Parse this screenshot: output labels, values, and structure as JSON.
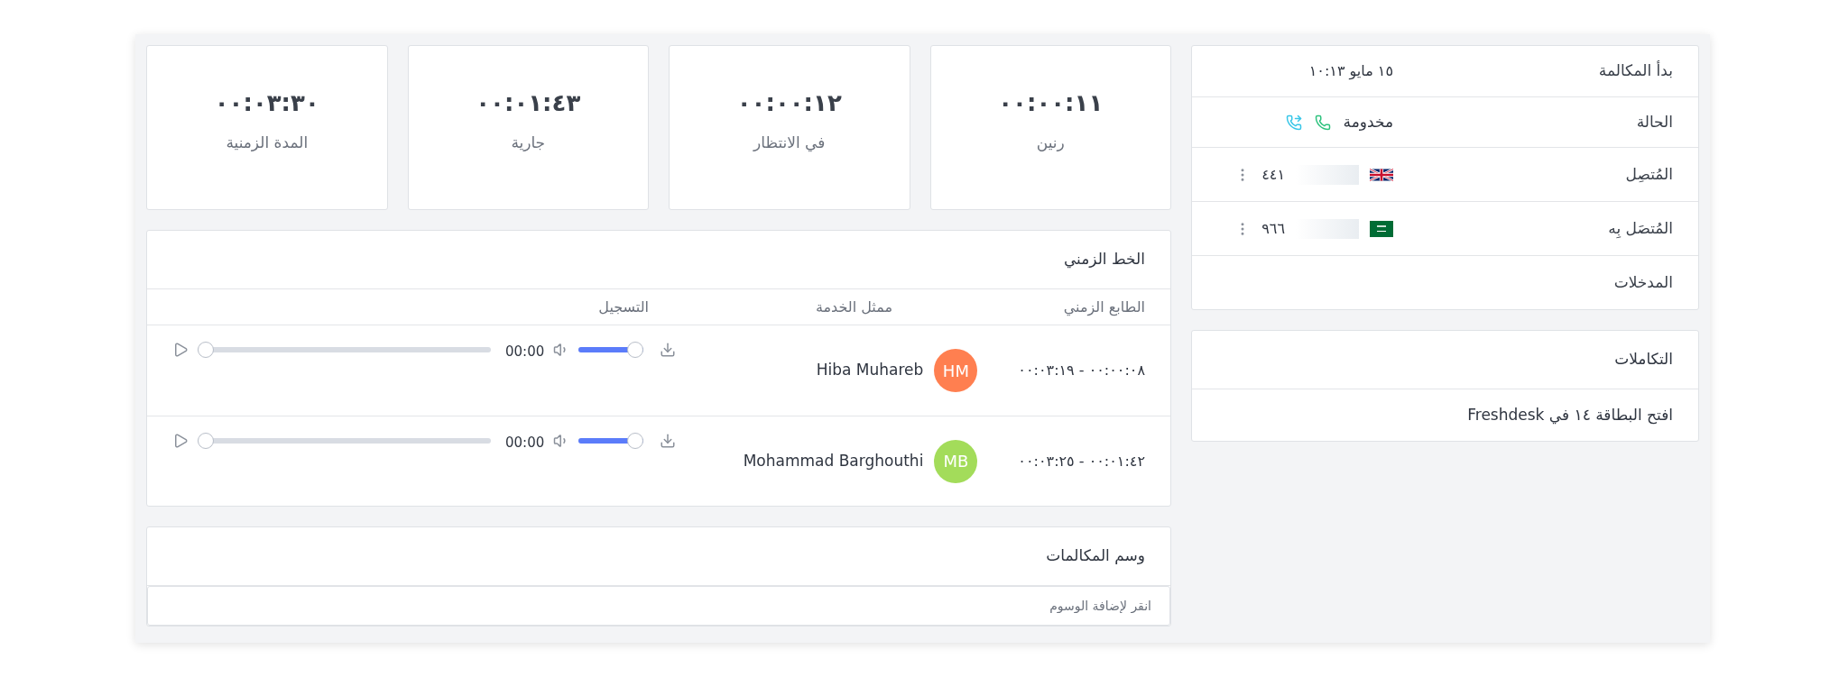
{
  "call_info": {
    "rows": [
      {
        "kind": "text",
        "label": "بدأ المكالمة",
        "value": "١٥ مايو ١٠:١٣"
      },
      {
        "kind": "status",
        "label": "الحالة",
        "value": "مخدومة"
      },
      {
        "kind": "caller",
        "label": "المُتصِل",
        "value": "٤٤١"
      },
      {
        "kind": "callee",
        "label": "المُتصَل بِه",
        "value": "٩٦٦"
      },
      {
        "kind": "label",
        "label": "المدخلات"
      }
    ]
  },
  "integrations": {
    "title": "التكاملات",
    "items": [
      "افتح البطاقة ١٤ في Freshdesk"
    ]
  },
  "stats": [
    {
      "value": "٠٠:٠٠:١١",
      "label": "رنين"
    },
    {
      "value": "٠٠:٠٠:١٢",
      "label": "في الانتظار"
    },
    {
      "value": "٠٠:٠١:٤٣",
      "label": "جارية"
    },
    {
      "value": "٠٠:٠٣:٣٠",
      "label": "المدة الزمنية"
    }
  ],
  "timeline": {
    "title": "الخط الزمني",
    "columns": [
      "الطابع الزمني",
      "ممثل الخدمة",
      "التسجيل"
    ],
    "rows": [
      {
        "timestamp": "٠٠:٠٠:٠٨ - ٠٠:٠٣:١٩",
        "agent": {
          "initials": "HM",
          "name": "Hiba Muhareb",
          "color": "#ff7f50"
        },
        "recording": {
          "time": "00:00",
          "progress": {
            "level": 0
          },
          "volume": {
            "level": 1
          }
        }
      },
      {
        "timestamp": "٠٠:٠١:٤٢ - ٠٠:٠٣:٢٥",
        "agent": {
          "initials": "MB",
          "name": "Mohammad Barghouthi",
          "color": "#a3dc5a"
        },
        "recording": {
          "time": "00:00",
          "progress": {
            "level": 0
          },
          "volume": {
            "level": 1
          }
        }
      }
    ]
  },
  "tags": {
    "title": "وسم المكالمات",
    "placeholder": "انقر لإضافة الوسوم"
  }
}
